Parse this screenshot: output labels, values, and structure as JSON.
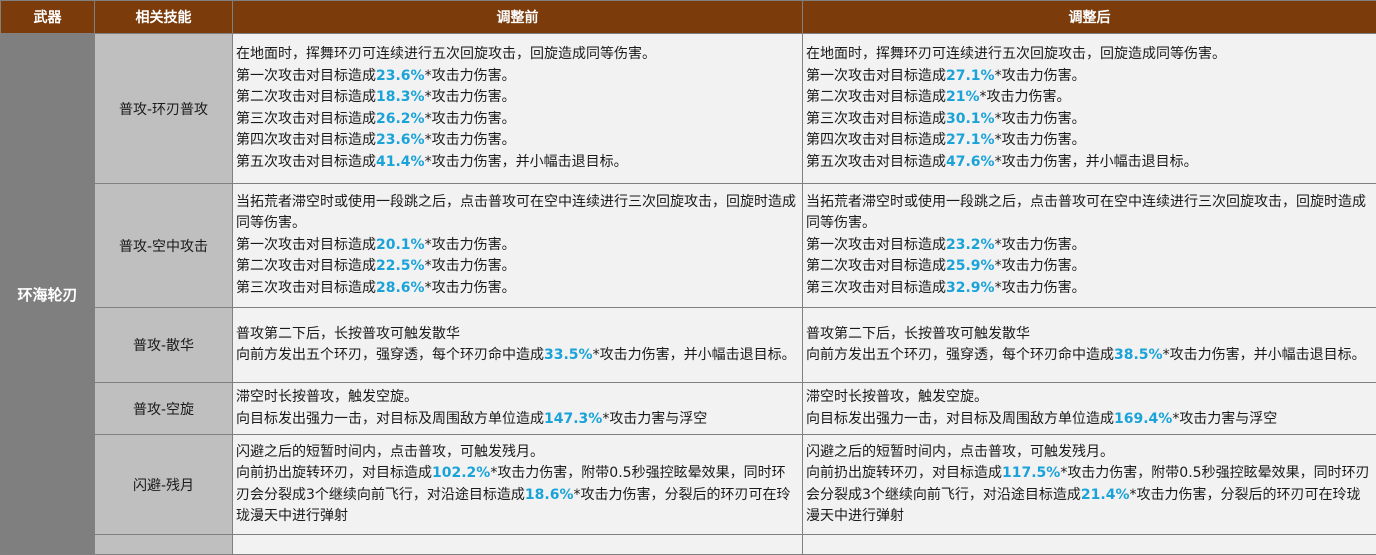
{
  "headers": {
    "weapon": "武器",
    "skill": "相关技能",
    "before": "调整前",
    "after": "调整后"
  },
  "weapon_name": "环海轮刃",
  "rows": [
    {
      "skill": "普攻-环刃普攻",
      "before": [
        [
          {
            "t": "在地面时，挥舞环刃可连续进行五次回旋攻击，回旋造成同等伤害。"
          }
        ],
        [
          {
            "t": "第一次攻击对目标造成"
          },
          {
            "t": "23.6%",
            "hl": true
          },
          {
            "t": "*攻击力伤害。"
          }
        ],
        [
          {
            "t": "第二次攻击对目标造成"
          },
          {
            "t": "18.3%",
            "hl": true
          },
          {
            "t": "*攻击力伤害。"
          }
        ],
        [
          {
            "t": "第三次攻击对目标造成"
          },
          {
            "t": "26.2%",
            "hl": true
          },
          {
            "t": "*攻击力伤害。"
          }
        ],
        [
          {
            "t": "第四次攻击对目标造成"
          },
          {
            "t": "23.6%",
            "hl": true
          },
          {
            "t": "*攻击力伤害。"
          }
        ],
        [
          {
            "t": "第五次攻击对目标造成"
          },
          {
            "t": "41.4%",
            "hl": true
          },
          {
            "t": "*攻击力伤害，并小幅击退目标。"
          }
        ]
      ],
      "after": [
        [
          {
            "t": "在地面时，挥舞环刃可连续进行五次回旋攻击，回旋造成同等伤害。"
          }
        ],
        [
          {
            "t": "第一次攻击对目标造成"
          },
          {
            "t": "27.1%",
            "hl": true
          },
          {
            "t": "*攻击力伤害。"
          }
        ],
        [
          {
            "t": "第二次攻击对目标造成"
          },
          {
            "t": "21%",
            "hl": true
          },
          {
            "t": "*攻击力伤害。"
          }
        ],
        [
          {
            "t": "第三次攻击对目标造成"
          },
          {
            "t": "30.1%",
            "hl": true
          },
          {
            "t": "*攻击力伤害。"
          }
        ],
        [
          {
            "t": "第四次攻击对目标造成"
          },
          {
            "t": "27.1%",
            "hl": true
          },
          {
            "t": "*攻击力伤害。"
          }
        ],
        [
          {
            "t": "第五次攻击对目标造成"
          },
          {
            "t": "47.6%",
            "hl": true
          },
          {
            "t": "*攻击力伤害，并小幅击退目标。"
          }
        ]
      ]
    },
    {
      "skill": "普攻-空中攻击",
      "before": [
        [
          {
            "t": "当拓荒者滞空时或使用一段跳之后，点击普攻可在空中连续进行三次回旋攻击，回旋时造成同等伤害。"
          }
        ],
        [
          {
            "t": "第一次攻击对目标造成"
          },
          {
            "t": "20.1%",
            "hl": true
          },
          {
            "t": "*攻击力伤害。"
          }
        ],
        [
          {
            "t": "第二次攻击对目标造成"
          },
          {
            "t": "22.5%",
            "hl": true
          },
          {
            "t": "*攻击力伤害。"
          }
        ],
        [
          {
            "t": "第三次攻击对目标造成"
          },
          {
            "t": "28.6%",
            "hl": true
          },
          {
            "t": "*攻击力伤害。"
          }
        ]
      ],
      "after": [
        [
          {
            "t": "当拓荒者滞空时或使用一段跳之后，点击普攻可在空中连续进行三次回旋攻击，回旋时造成同等伤害。"
          }
        ],
        [
          {
            "t": "第一次攻击对目标造成"
          },
          {
            "t": "23.2%",
            "hl": true
          },
          {
            "t": "*攻击力伤害。"
          }
        ],
        [
          {
            "t": "第二次攻击对目标造成"
          },
          {
            "t": "25.9%",
            "hl": true
          },
          {
            "t": "*攻击力伤害。"
          }
        ],
        [
          {
            "t": "第三次攻击对目标造成"
          },
          {
            "t": "32.9%",
            "hl": true
          },
          {
            "t": "*攻击力伤害。"
          }
        ]
      ]
    },
    {
      "skill": "普攻-散华",
      "before": [
        [
          {
            "t": "普攻第二下后，长按普攻可触发散华"
          }
        ],
        [
          {
            "t": "向前方发出五个环刃，强穿透，每个环刃命中造成"
          },
          {
            "t": "33.5%",
            "hl": true
          },
          {
            "t": "*攻击力伤害，并小幅击退目标。"
          }
        ]
      ],
      "after": [
        [
          {
            "t": "普攻第二下后，长按普攻可触发散华"
          }
        ],
        [
          {
            "t": "向前方发出五个环刃，强穿透，每个环刃命中造成"
          },
          {
            "t": "38.5%",
            "hl": true
          },
          {
            "t": "*攻击力伤害，并小幅击退目标。"
          }
        ]
      ]
    },
    {
      "skill": "普攻-空旋",
      "before": [
        [
          {
            "t": "滞空时长按普攻，触发空旋。"
          }
        ],
        [
          {
            "t": "向目标发出强力一击，对目标及周围敌方单位造成"
          },
          {
            "t": "147.3%",
            "hl": true
          },
          {
            "t": "*攻击力害与浮空"
          }
        ]
      ],
      "after": [
        [
          {
            "t": "滞空时长按普攻，触发空旋。"
          }
        ],
        [
          {
            "t": "向目标发出强力一击，对目标及周围敌方单位造成"
          },
          {
            "t": "169.4%",
            "hl": true
          },
          {
            "t": "*攻击力害与浮空"
          }
        ]
      ]
    },
    {
      "skill": "闪避-残月",
      "before": [
        [
          {
            "t": "闪避之后的短暂时间内，点击普攻，可触发残月。"
          }
        ],
        [
          {
            "t": "向前扔出旋转环刃，对目标造成"
          },
          {
            "t": "102.2%",
            "hl": true
          },
          {
            "t": "*攻击力伤害，附带0.5秒强控眩晕效果，同时环刃会分裂成3个继续向前飞行，对沿途目标造成"
          },
          {
            "t": "18.6%",
            "hl": true
          },
          {
            "t": "*攻击力伤害，分裂后的环刃可在玲珑漫天中进行弹射"
          }
        ]
      ],
      "after": [
        [
          {
            "t": "闪避之后的短暂时间内，点击普攻，可触发残月。"
          }
        ],
        [
          {
            "t": "向前扔出旋转环刃，对目标造成"
          },
          {
            "t": "117.5%",
            "hl": true
          },
          {
            "t": "*攻击力伤害，附带0.5秒强控眩晕效果，同时环刃会分裂成3个继续向前飞行，对沿途目标造成"
          },
          {
            "t": "21.4%",
            "hl": true
          },
          {
            "t": "*攻击力伤害，分裂后的环刃可在玲珑漫天中进行弹射"
          }
        ]
      ]
    }
  ],
  "colors": {
    "header_bg": "#7b3b0b",
    "weapon_bg": "#7f7f7f",
    "skill_bg": "#bfbfbf",
    "desc_bg": "#f2f2f2",
    "highlight": "#1aa3d9"
  }
}
